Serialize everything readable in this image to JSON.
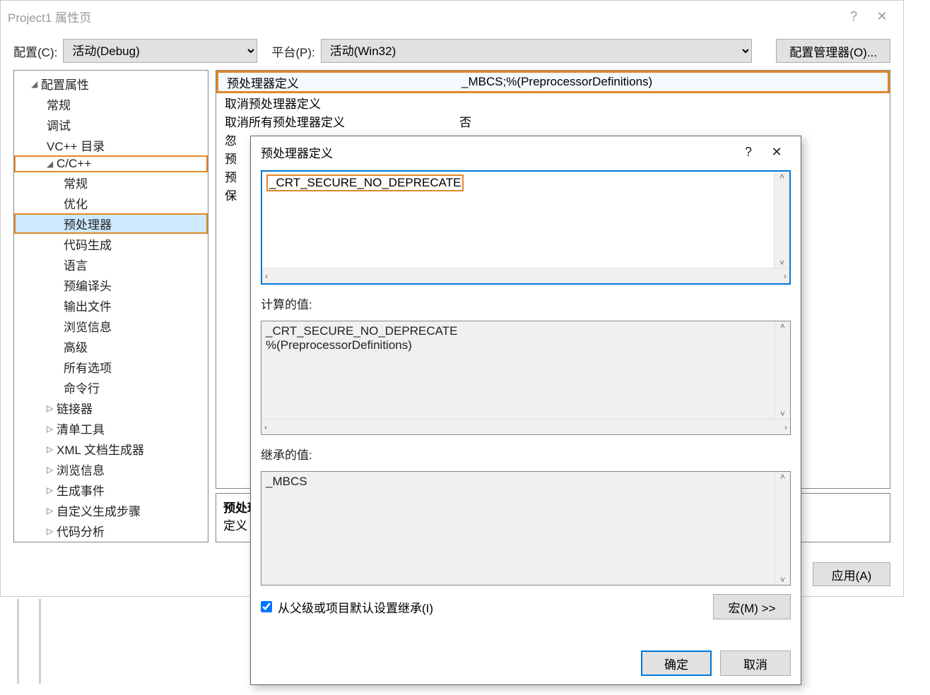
{
  "window": {
    "title": "Project1 属性页",
    "help": "?",
    "close": "✕"
  },
  "toolbar": {
    "config_label": "配置(C):",
    "config_value": "活动(Debug)",
    "platform_label": "平台(P):",
    "platform_value": "活动(Win32)",
    "manager_btn": "配置管理器(O)..."
  },
  "tree": {
    "root": "配置属性",
    "items": [
      "常规",
      "调试",
      "VC++ 目录"
    ],
    "cpp": "C/C++",
    "cpp_items": [
      "常规",
      "优化",
      "预处理器",
      "代码生成",
      "语言",
      "预编译头",
      "输出文件",
      "浏览信息",
      "高级",
      "所有选项",
      "命令行"
    ],
    "rest": [
      "链接器",
      "清单工具",
      "XML 文档生成器",
      "浏览信息",
      "生成事件",
      "自定义生成步骤",
      "代码分析"
    ]
  },
  "props": {
    "r1k": "预处理器定义",
    "r1v": "_MBCS;%(PreprocessorDefinitions)",
    "r2k": "取消预处理器定义",
    "r2v": "",
    "r3k": "取消所有预处理器定义",
    "r3v": "否",
    "r4k": "忽",
    "r5k": "预",
    "r6k": "预",
    "r7k": "保"
  },
  "desc": {
    "title": "预处理",
    "body": "定义"
  },
  "footer": {
    "apply": "应用(A)"
  },
  "dialog": {
    "title": "预处理器定义",
    "help": "?",
    "close": "✕",
    "edit_value": "_CRT_SECURE_NO_DEPRECATE",
    "calc_label": "计算的值:",
    "calc_l1": "_CRT_SECURE_NO_DEPRECATE",
    "calc_l2": "%(PreprocessorDefinitions)",
    "inherit_label": "继承的值:",
    "inherit_l1": "_MBCS",
    "checkbox_label": "从父级或项目默认设置继承(I)",
    "macro_btn": "宏(M) >>",
    "ok": "确定",
    "cancel": "取消"
  }
}
